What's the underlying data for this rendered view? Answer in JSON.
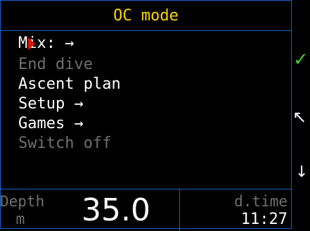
{
  "header": {
    "title": "OC mode"
  },
  "menu": {
    "items": [
      {
        "label": "Mix: →",
        "enabled": true
      },
      {
        "label": "End dive",
        "enabled": false
      },
      {
        "label": "Ascent plan",
        "enabled": true
      },
      {
        "label": "Setup →",
        "enabled": true
      },
      {
        "label": "Games →",
        "enabled": true
      },
      {
        "label": "Switch off",
        "enabled": false
      }
    ],
    "selected_index": 0
  },
  "side_buttons": {
    "top": {
      "icon": "check-icon",
      "glyph": "✓",
      "color": "#3ecb2d"
    },
    "middle": {
      "icon": "nw-arrow-icon",
      "glyph": "↖",
      "color": "#ffffff"
    },
    "bottom": {
      "icon": "down-arrow-icon",
      "glyph": "↓",
      "color": "#ffffff"
    }
  },
  "status": {
    "depth_label": "Depth",
    "depth_unit": "m",
    "depth_value": "35.0",
    "dtime_label": "d.time",
    "dtime_value": "11:27"
  },
  "colors": {
    "title": "#ffd400",
    "border": "#1a5fc8",
    "cursor": "#e0140e",
    "enabled_text": "#ffffff",
    "disabled_text": "#707070"
  }
}
